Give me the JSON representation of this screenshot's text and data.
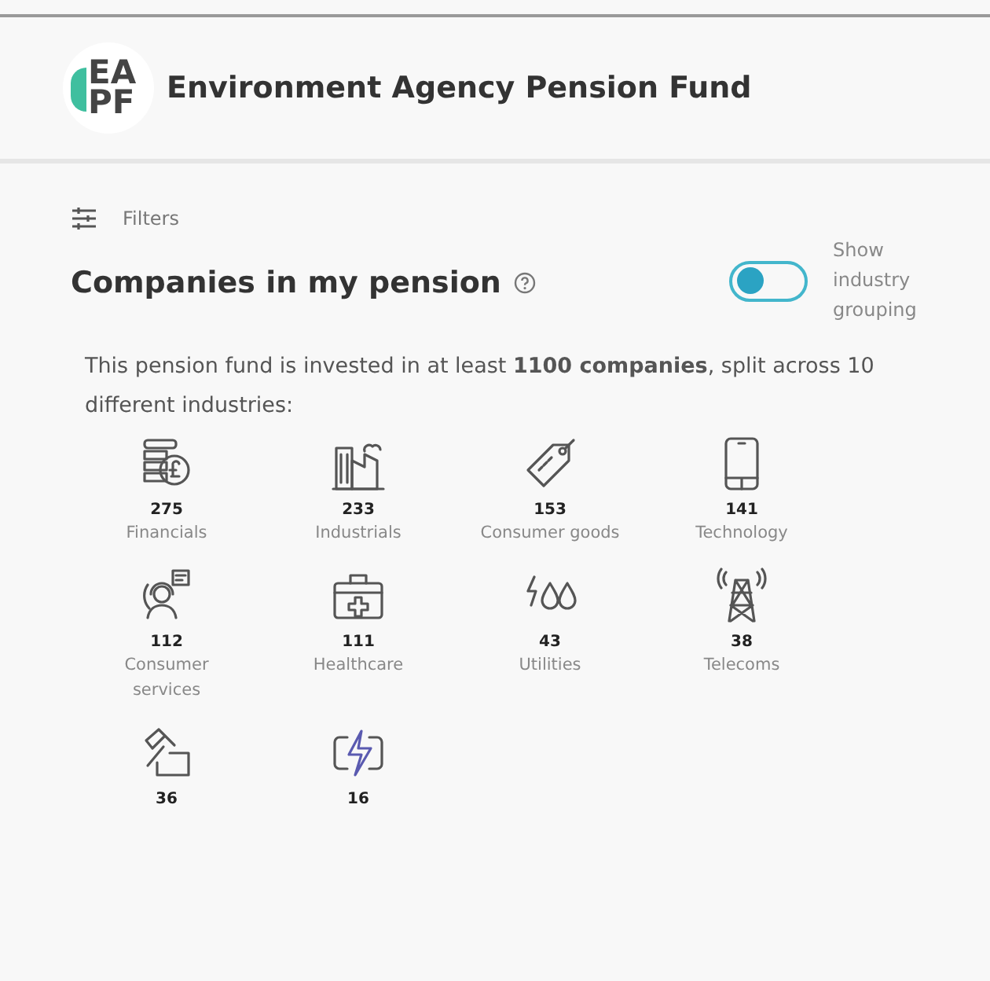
{
  "header": {
    "logo_top": "EA",
    "logo_bottom": "PF",
    "title": "Environment Agency Pension Fund"
  },
  "filters": {
    "label": "Filters"
  },
  "section": {
    "title": "Companies in my pension",
    "toggle": {
      "on": false,
      "label": "Show industry grouping"
    }
  },
  "summary": "This pension fund is invested in at least **1100 companies**, split across 10 different industries:",
  "industries": [
    {
      "kind": "coins",
      "count": "275",
      "label": "Financials"
    },
    {
      "kind": "factory",
      "count": "233",
      "label": "Industrials"
    },
    {
      "kind": "tag",
      "count": "153",
      "label": "Consumer goods"
    },
    {
      "kind": "phone",
      "count": "141",
      "label": "Technology"
    },
    {
      "kind": "support",
      "count": "112",
      "label": "Consumer services"
    },
    {
      "kind": "medkit",
      "count": "111",
      "label": "Healthcare"
    },
    {
      "kind": "drops",
      "count": "43",
      "label": "Utilities"
    },
    {
      "kind": "tower",
      "count": "38",
      "label": "Telecoms"
    },
    {
      "kind": "tools",
      "count": "36"
    },
    {
      "kind": "battery",
      "count": "16"
    }
  ]
}
